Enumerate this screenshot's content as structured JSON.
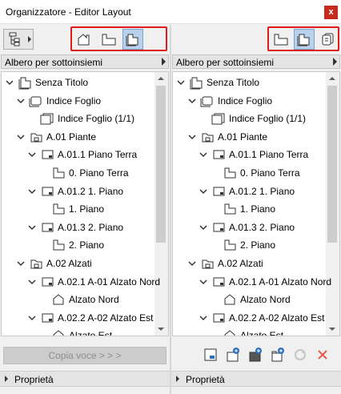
{
  "window": {
    "title": "Organizzatore - Editor Layout",
    "close_label": "x"
  },
  "left": {
    "view_buttons": [
      {
        "icon": "project-map-icon",
        "selected": false
      },
      {
        "icon": "view-map-icon",
        "selected": false
      },
      {
        "icon": "layout-book-icon",
        "selected": true
      }
    ],
    "dropdown_label": "Albero per sottoinsiemi",
    "tree": [
      {
        "label": "Senza Titolo",
        "level": 0,
        "expand": "open",
        "icon": "book"
      },
      {
        "label": "Indice Foglio",
        "level": 1,
        "expand": "open",
        "icon": "sheet"
      },
      {
        "label": "Indice Foglio (1/1)",
        "level": 2,
        "expand": "none",
        "icon": "page"
      },
      {
        "label": "A.01 Piante",
        "level": 1,
        "expand": "open",
        "icon": "subset"
      },
      {
        "label": "A.01.1 Piano Terra",
        "level": 2,
        "expand": "open",
        "icon": "layout"
      },
      {
        "label": "0. Piano Terra",
        "level": 3,
        "expand": "none",
        "icon": "view"
      },
      {
        "label": "A.01.2 1. Piano",
        "level": 2,
        "expand": "open",
        "icon": "layout"
      },
      {
        "label": "1. Piano",
        "level": 3,
        "expand": "none",
        "icon": "view"
      },
      {
        "label": "A.01.3 2. Piano",
        "level": 2,
        "expand": "open",
        "icon": "layout"
      },
      {
        "label": "2. Piano",
        "level": 3,
        "expand": "none",
        "icon": "view"
      },
      {
        "label": "A.02 Alzati",
        "level": 1,
        "expand": "open",
        "icon": "subset"
      },
      {
        "label": "A.02.1 A-01 Alzato Nord",
        "level": 2,
        "expand": "open",
        "icon": "layout"
      },
      {
        "label": "Alzato Nord",
        "level": 3,
        "expand": "none",
        "icon": "elevation"
      },
      {
        "label": "A.02.2 A-02 Alzato Est",
        "level": 2,
        "expand": "open",
        "icon": "layout"
      },
      {
        "label": "Alzato Est",
        "level": 3,
        "expand": "none",
        "icon": "elevation"
      }
    ],
    "copy_button": "Copia voce > > >",
    "properties_label": "Proprietà"
  },
  "right": {
    "view_buttons": [
      {
        "icon": "view-map-icon",
        "selected": false
      },
      {
        "icon": "layout-book-icon",
        "selected": true
      },
      {
        "icon": "publisher-icon",
        "selected": false
      }
    ],
    "dropdown_label": "Albero per sottoinsiemi",
    "tree": [
      {
        "label": "Senza Titolo",
        "level": 0,
        "expand": "open",
        "icon": "book"
      },
      {
        "label": "Indice Foglio",
        "level": 1,
        "expand": "open",
        "icon": "sheet"
      },
      {
        "label": "Indice Foglio (1/1)",
        "level": 2,
        "expand": "none",
        "icon": "page"
      },
      {
        "label": "A.01 Piante",
        "level": 1,
        "expand": "open",
        "icon": "subset"
      },
      {
        "label": "A.01.1 Piano Terra",
        "level": 2,
        "expand": "open",
        "icon": "layout"
      },
      {
        "label": "0. Piano Terra",
        "level": 3,
        "expand": "none",
        "icon": "view"
      },
      {
        "label": "A.01.2 1. Piano",
        "level": 2,
        "expand": "open",
        "icon": "layout"
      },
      {
        "label": "1. Piano",
        "level": 3,
        "expand": "none",
        "icon": "view"
      },
      {
        "label": "A.01.3 2. Piano",
        "level": 2,
        "expand": "open",
        "icon": "layout"
      },
      {
        "label": "2. Piano",
        "level": 3,
        "expand": "none",
        "icon": "view"
      },
      {
        "label": "A.02 Alzati",
        "level": 1,
        "expand": "open",
        "icon": "subset"
      },
      {
        "label": "A.02.1 A-01 Alzato Nord",
        "level": 2,
        "expand": "open",
        "icon": "layout"
      },
      {
        "label": "Alzato Nord",
        "level": 3,
        "expand": "none",
        "icon": "elevation"
      },
      {
        "label": "A.02.2 A-02 Alzato Est",
        "level": 2,
        "expand": "open",
        "icon": "layout"
      },
      {
        "label": "Alzato Est",
        "level": 3,
        "expand": "none",
        "icon": "elevation"
      }
    ],
    "actions": [
      {
        "icon": "new-layout-icon",
        "enabled": true
      },
      {
        "icon": "new-subset-icon",
        "enabled": true
      },
      {
        "icon": "new-master-icon",
        "enabled": true
      },
      {
        "icon": "new-folder-icon",
        "enabled": true
      },
      {
        "icon": "refresh-icon",
        "enabled": false
      },
      {
        "icon": "delete-icon",
        "enabled": true
      }
    ],
    "properties_label": "Proprietà"
  },
  "colors": {
    "selection": "#b8d2ee",
    "highlight_box": "#e01b1b",
    "close": "#c42b1c",
    "delete": "#e85a50"
  }
}
